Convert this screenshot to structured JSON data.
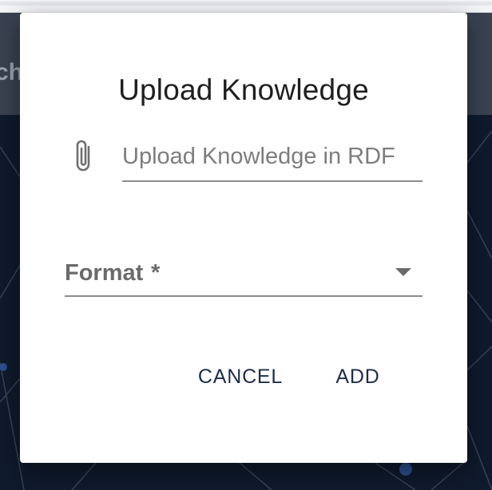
{
  "background": {
    "header_text": "ch",
    "header_color": "#3a4251",
    "canvas_color": "#0f1a2c"
  },
  "dialog": {
    "title": "Upload Knowledge",
    "upload_field": {
      "icon": "paperclip-icon",
      "placeholder": "Upload Knowledge in RDF"
    },
    "format_select": {
      "label": "Format",
      "required_marker": "*",
      "icon": "dropdown-arrow-icon"
    },
    "actions": {
      "cancel_label": "CANCEL",
      "add_label": "ADD",
      "button_color": "#1f2d48"
    }
  }
}
